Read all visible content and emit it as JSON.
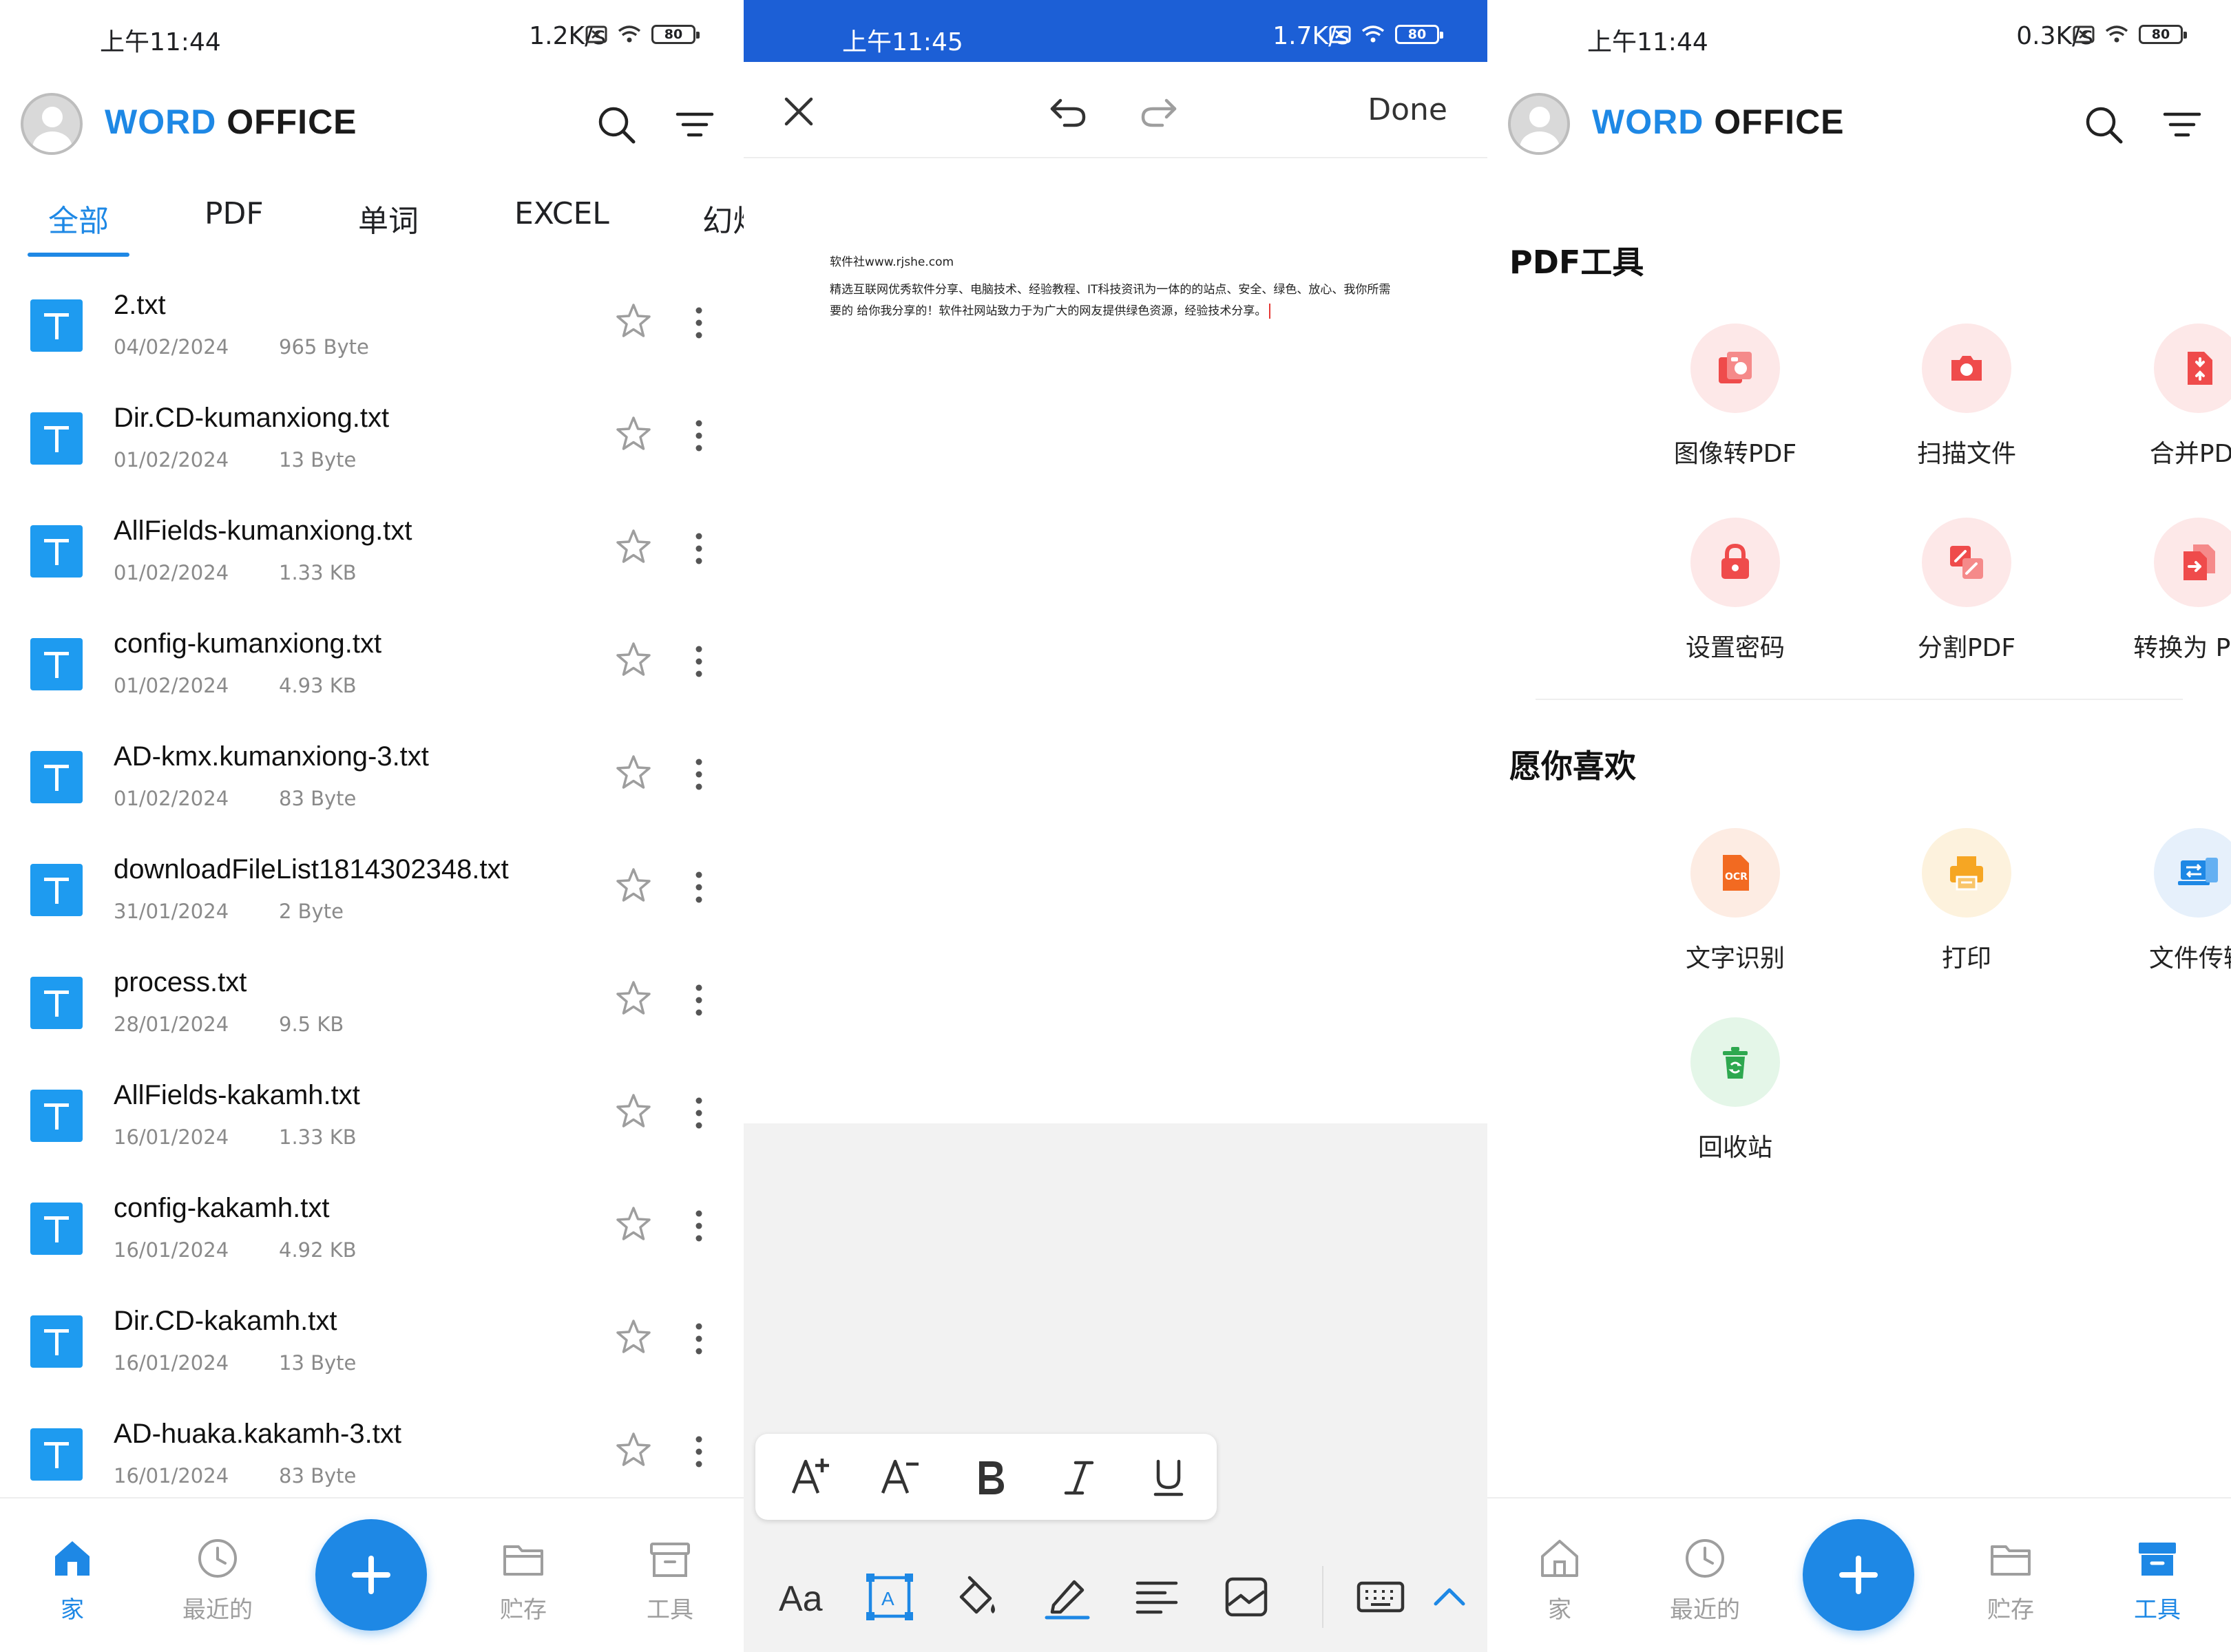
{
  "colors": {
    "accent": "#1e88e5",
    "editor_status_bar": "#1c5fd6",
    "file_icon": "#1e9bf0",
    "pdf_tool_tint": "#fde8e8",
    "pdf_tool_icon": "#ef4b4b",
    "ocr_tint": "#fdece3",
    "ocr_icon": "#f26a21",
    "print_tint": "#fdf2dd",
    "print_icon": "#f6a623",
    "transfer_tint": "#e6f0fb",
    "transfer_icon": "#1e88e5",
    "recycle_tint": "#e4f6e8",
    "recycle_icon": "#2ea84f"
  },
  "panel1": {
    "status": {
      "time": "上午11:44",
      "net": "1.2K/s",
      "battery": "80"
    },
    "header": {
      "brand_accent": "WORD",
      "brand_rest": " OFFICE"
    },
    "tabs": [
      "全部",
      "PDF",
      "单词",
      "EXCEL",
      "幻灯"
    ],
    "files": [
      {
        "name": "2.txt",
        "date": "04/02/2024",
        "size": "965 Byte"
      },
      {
        "name": "Dir.CD-kumanxiong.txt",
        "date": "01/02/2024",
        "size": "13 Byte"
      },
      {
        "name": "AllFields-kumanxiong.txt",
        "date": "01/02/2024",
        "size": "1.33 KB"
      },
      {
        "name": "config-kumanxiong.txt",
        "date": "01/02/2024",
        "size": "4.93 KB"
      },
      {
        "name": "AD-kmx.kumanxiong-3.txt",
        "date": "01/02/2024",
        "size": "83 Byte"
      },
      {
        "name": "downloadFileList1814302348.txt",
        "date": "31/01/2024",
        "size": "2 Byte"
      },
      {
        "name": "process.txt",
        "date": "28/01/2024",
        "size": "9.5 KB"
      },
      {
        "name": "AllFields-kakamh.txt",
        "date": "16/01/2024",
        "size": "1.33 KB"
      },
      {
        "name": "config-kakamh.txt",
        "date": "16/01/2024",
        "size": "4.92 KB"
      },
      {
        "name": "Dir.CD-kakamh.txt",
        "date": "16/01/2024",
        "size": "13 Byte"
      },
      {
        "name": "AD-huaka.kakamh-3.txt",
        "date": "16/01/2024",
        "size": "83 Byte"
      }
    ],
    "nav": {
      "home": "家",
      "recent": "最近的",
      "storage": "贮存",
      "tools": "工具"
    }
  },
  "panel2": {
    "status": {
      "time": "上午11:45",
      "net": "1.7K/s",
      "battery": "80"
    },
    "done_label": "Done",
    "doc_title": "软件社www.rjshe.com",
    "doc_body": "精选互联网优秀软件分享、电脑技术、经验教程、IT科技资讯为一体的的站点、安全、绿色、放心、我你所需要的 给你我分享的！软件社网站致力于为广大的网友提供绿色资源，经验技术分享。"
  },
  "panel3": {
    "status": {
      "time": "上午11:44",
      "net": "0.3K/s",
      "battery": "80"
    },
    "header": {
      "brand_accent": "WORD",
      "brand_rest": " OFFICE"
    },
    "pdf_section": "PDF工具",
    "pdf_tools": [
      "图像转PDF",
      "扫描文件",
      "合并PDF",
      "设置密码",
      "分割PDF",
      "转换为 PDF"
    ],
    "like_section": "愿你喜欢",
    "like_tools": [
      "文字识别",
      "打印",
      "文件传输",
      "回收站"
    ],
    "nav": {
      "home": "家",
      "recent": "最近的",
      "storage": "贮存",
      "tools": "工具"
    }
  }
}
